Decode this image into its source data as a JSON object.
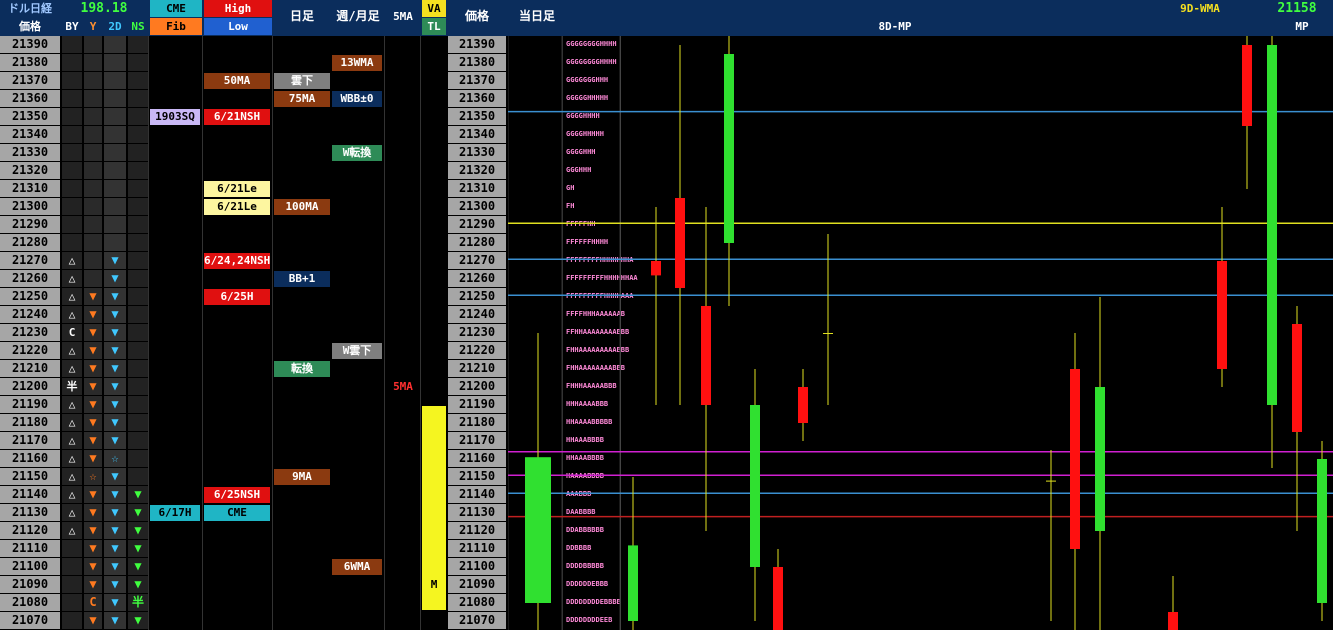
{
  "header": {
    "dollar_nikkei_label": "ドル日経",
    "dollar_nikkei_value": "198.18",
    "price_label": "価格",
    "by": "BY",
    "y": "Y",
    "twod": "2D",
    "ns": "NS",
    "cme": "CME",
    "fib": "Fib",
    "high": "High",
    "low": "Low",
    "daily": "日足",
    "weekly_monthly": "週/月足",
    "ma5": "5MA",
    "va": "VA",
    "tl": "TL",
    "price_label2": "価格",
    "today_candle": "当日足",
    "mp8d": "8D-MP",
    "wma9d": "9D-WMA",
    "mp_value": "21158",
    "mp": "MP"
  },
  "rows": [
    {
      "price": "21390",
      "by": "",
      "y": "",
      "d2": "",
      "ns": "",
      "cme": "",
      "hl": "",
      "hl_color": "",
      "daily": "",
      "weekly": "",
      "tpo": "GGGGGGGGHHHH"
    },
    {
      "price": "21380",
      "by": "",
      "y": "",
      "d2": "",
      "ns": "",
      "cme": "",
      "hl": "",
      "hl_color": "",
      "daily": "",
      "weekly": "13WMA",
      "tpo": "GGGGGGGGHHHH"
    },
    {
      "price": "21370",
      "by": "",
      "y": "",
      "d2": "",
      "ns": "",
      "cme": "",
      "hl": "50MA",
      "hl_color": "#8b3a10",
      "daily": "雲下",
      "weekly": "",
      "tpo": "GGGGGGGHHH"
    },
    {
      "price": "21360",
      "by": "",
      "y": "",
      "d2": "",
      "ns": "",
      "cme": "",
      "hl": "",
      "hl_color": "",
      "daily": "75MA",
      "weekly": "WBB±0",
      "tpo": "GGGGGHHHHH"
    },
    {
      "price": "21350",
      "by": "",
      "y": "",
      "d2": "",
      "ns": "",
      "cme": "1903SQ",
      "hl": "6/21NSH",
      "hl_color": "#e01010",
      "daily": "",
      "weekly": "",
      "tpo": "GGGGHHHH"
    },
    {
      "price": "21340",
      "by": "",
      "y": "",
      "d2": "",
      "ns": "",
      "cme": "",
      "hl": "",
      "hl_color": "",
      "daily": "",
      "weekly": "",
      "tpo": "GGGGHHHHH"
    },
    {
      "price": "21330",
      "by": "",
      "y": "",
      "d2": "",
      "ns": "",
      "cme": "",
      "hl": "",
      "hl_color": "",
      "daily": "",
      "weekly": "W転換",
      "tpo": "GGGGHHH"
    },
    {
      "price": "21320",
      "by": "",
      "y": "",
      "d2": "",
      "ns": "",
      "cme": "",
      "hl": "",
      "hl_color": "",
      "daily": "",
      "weekly": "",
      "tpo": "GGGHHH"
    },
    {
      "price": "21310",
      "by": "",
      "y": "",
      "d2": "",
      "ns": "",
      "cme": "",
      "hl": "6/21Le",
      "hl_color": "#fdf6a0",
      "daily": "",
      "weekly": "",
      "tpo": "GH"
    },
    {
      "price": "21300",
      "by": "",
      "y": "",
      "d2": "",
      "ns": "",
      "cme": "",
      "hl": "6/21Le",
      "hl_color": "#fdf6a0",
      "daily": "100MA",
      "weekly": "",
      "tpo": "FH"
    },
    {
      "price": "21290",
      "by": "",
      "y": "",
      "d2": "",
      "ns": "",
      "cme": "",
      "hl": "",
      "hl_color": "",
      "daily": "",
      "weekly": "",
      "tpo": "FFFFFHH"
    },
    {
      "price": "21280",
      "by": "",
      "y": "",
      "d2": "",
      "ns": "",
      "cme": "",
      "hl": "",
      "hl_color": "",
      "daily": "",
      "weekly": "",
      "tpo": "FFFFFFHHHH"
    },
    {
      "price": "21270",
      "by": "△",
      "y": "",
      "d2": "▼",
      "ns": "",
      "cme": "",
      "hl": "6/24,24NSH",
      "hl_color": "#e01010",
      "daily": "",
      "weekly": "",
      "tpo": "FFFFFFFFHHHHHHHA"
    },
    {
      "price": "21260",
      "by": "△",
      "y": "",
      "d2": "▼",
      "ns": "",
      "cme": "",
      "hl": "",
      "hl_color": "",
      "daily": "BB+1",
      "weekly": "",
      "tpo": "FFFFFFFFFHHHHHHAA"
    },
    {
      "price": "21250",
      "by": "△",
      "y": "▼",
      "d2": "▼",
      "ns": "",
      "cme": "",
      "hl": "6/25H",
      "hl_color": "#e01010",
      "daily": "",
      "weekly": "",
      "tpo": "FFFFFFFFFHHHHAAA"
    },
    {
      "price": "21240",
      "by": "△",
      "y": "▼",
      "d2": "▼",
      "ns": "",
      "cme": "",
      "hl": "",
      "hl_color": "",
      "daily": "",
      "weekly": "",
      "tpo": "FFFFHHHAAAAAAB"
    },
    {
      "price": "21230",
      "by": "C",
      "y": "▼",
      "d2": "▼",
      "ns": "",
      "cme": "",
      "hl": "",
      "hl_color": "",
      "daily": "",
      "weekly": "",
      "tpo": "FFHHAAAAAAAABBB"
    },
    {
      "price": "21220",
      "by": "△",
      "y": "▼",
      "d2": "▼",
      "ns": "",
      "cme": "",
      "hl": "",
      "hl_color": "",
      "daily": "",
      "weekly": "W雲下",
      "tpo": "FHHAAAAAAAAABBB"
    },
    {
      "price": "21210",
      "by": "△",
      "y": "▼",
      "d2": "▼",
      "ns": "",
      "cme": "",
      "hl": "",
      "hl_color": "",
      "daily": "転換",
      "weekly": "",
      "tpo": "FHHAAAAAAAABBB"
    },
    {
      "price": "21200",
      "by": "半",
      "y": "▼",
      "d2": "▼",
      "ns": "",
      "cme": "",
      "hl": "",
      "hl_color": "",
      "daily": "",
      "weekly": "",
      "tpo": "FHHHAAAAABBB"
    },
    {
      "price": "21190",
      "by": "△",
      "y": "▼",
      "d2": "▼",
      "ns": "",
      "cme": "",
      "hl": "",
      "hl_color": "",
      "daily": "",
      "weekly": "",
      "tpo": "HHHAAAABBB"
    },
    {
      "price": "21180",
      "by": "△",
      "y": "▼",
      "d2": "▼",
      "ns": "",
      "cme": "",
      "hl": "",
      "hl_color": "",
      "daily": "",
      "weekly": "",
      "tpo": "HHAAAABBBBB"
    },
    {
      "price": "21170",
      "by": "△",
      "y": "▼",
      "d2": "▼",
      "ns": "",
      "cme": "",
      "hl": "",
      "hl_color": "",
      "daily": "",
      "weekly": "",
      "tpo": "HHAAABBBB"
    },
    {
      "price": "21160",
      "by": "△",
      "y": "▼",
      "d2": "☆",
      "ns": "",
      "cme": "",
      "hl": "",
      "hl_color": "",
      "daily": "",
      "weekly": "",
      "tpo": "HHAAABBBB"
    },
    {
      "price": "21150",
      "by": "△",
      "y": "☆",
      "d2": "▼",
      "ns": "",
      "cme": "",
      "hl": "",
      "hl_color": "",
      "daily": "9MA",
      "weekly": "",
      "tpo": "HAAAABBBB"
    },
    {
      "price": "21140",
      "by": "△",
      "y": "▼",
      "d2": "▼",
      "ns": "▼",
      "cme": "",
      "hl": "6/25NSH",
      "hl_color": "#e01010",
      "daily": "",
      "weekly": "",
      "tpo": "AAABBB"
    },
    {
      "price": "21130",
      "by": "△",
      "y": "▼",
      "d2": "▼",
      "ns": "▼",
      "cme": "6/17H",
      "hl": "CME",
      "hl_color": "#1fb5c5",
      "daily": "",
      "weekly": "",
      "tpo": "DAABBBB"
    },
    {
      "price": "21120",
      "by": "△",
      "y": "▼",
      "d2": "▼",
      "ns": "▼",
      "cme": "",
      "hl": "",
      "hl_color": "",
      "daily": "",
      "weekly": "",
      "tpo": "DDABBBBBB"
    },
    {
      "price": "21110",
      "by": "",
      "y": "▼",
      "d2": "▼",
      "ns": "▼",
      "cme": "",
      "hl": "",
      "hl_color": "",
      "daily": "",
      "weekly": "",
      "tpo": "DDBBBB"
    },
    {
      "price": "21100",
      "by": "",
      "y": "▼",
      "d2": "▼",
      "ns": "▼",
      "cme": "",
      "hl": "",
      "hl_color": "",
      "daily": "",
      "weekly": "6WMA",
      "tpo": "DDDDBBBBB"
    },
    {
      "price": "21090",
      "by": "",
      "y": "▼",
      "d2": "▼",
      "ns": "▼",
      "cme": "",
      "hl": "",
      "hl_color": "",
      "daily": "",
      "weekly": "",
      "tpo": "DDDDDDEBBB"
    },
    {
      "price": "21080",
      "by": "",
      "y": "C",
      "d2": "▼",
      "ns": "半",
      "cme": "",
      "hl": "",
      "hl_color": "",
      "daily": "",
      "weekly": "",
      "tpo": "DDDDDDDDEBBBB"
    },
    {
      "price": "21070",
      "by": "",
      "y": "▼",
      "d2": "▼",
      "ns": "▼",
      "cme": "",
      "hl": "",
      "hl_color": "",
      "daily": "",
      "weekly": "",
      "tpo": "DDDDDDDDEEB"
    }
  ],
  "weekly_tags": {
    "13WMA": "#8b3a10",
    "6WMA": "#8b3a10",
    "WBB±0": "#0b2d5c",
    "W転換": "#2e8b57",
    "W雲下": "#7f7f7f"
  },
  "daily_tags": {
    "75MA": "#8b3a10",
    "100MA": "#8b3a10",
    "9MA": "#8b3a10",
    "BB+1": "#0b2d5c",
    "転換": "#2e8b57",
    "雲下": "#7f7f7f"
  },
  "ma5_label": {
    "text": "5MA",
    "price": "21200",
    "color": "#ff3030"
  },
  "va_marker": {
    "text": "M",
    "price": "21090"
  },
  "chart_data": {
    "type": "candlestick",
    "title": "",
    "ylim": [
      21065,
      21395
    ],
    "horizontal_lines": [
      {
        "price": 21353,
        "color": "#3a8fd0"
      },
      {
        "price": 21291,
        "color": "#e0e020"
      },
      {
        "price": 21271,
        "color": "#3a8fd0"
      },
      {
        "price": 21251,
        "color": "#3a8fd0"
      },
      {
        "price": 21164,
        "color": "#d020d0"
      },
      {
        "price": 21151,
        "color": "#d020d0"
      },
      {
        "price": 21141,
        "color": "#3a8fd0"
      },
      {
        "price": 21128,
        "color": "#c02020"
      }
    ],
    "today_candle": {
      "open": 21080,
      "close": 21161,
      "high": 21230,
      "low": 21065,
      "color": "#30e030"
    },
    "candles": [
      {
        "x": 633,
        "open": 21070,
        "close": 21112,
        "high": 21150,
        "low": 21060,
        "color": "#30e030"
      },
      {
        "x": 656,
        "open": 21270,
        "close": 21262,
        "high": 21300,
        "low": 21190,
        "color": "#ff1010"
      },
      {
        "x": 680,
        "open": 21305,
        "close": 21255,
        "high": 21390,
        "low": 21190,
        "color": "#ff1010"
      },
      {
        "x": 706,
        "open": 21245,
        "close": 21190,
        "high": 21300,
        "low": 21120,
        "color": "#ff1010"
      },
      {
        "x": 729,
        "open": 21280,
        "close": 21385,
        "high": 21395,
        "low": 21245,
        "color": "#30e030"
      },
      {
        "x": 755,
        "open": 21100,
        "close": 21190,
        "high": 21210,
        "low": 21070,
        "color": "#30e030"
      },
      {
        "x": 778,
        "open": 21100,
        "close": 21060,
        "high": 21110,
        "low": 21030,
        "color": "#ff1010"
      },
      {
        "x": 803,
        "open": 21200,
        "close": 21180,
        "high": 21210,
        "low": 21170,
        "color": "#ff1010"
      },
      {
        "x": 828,
        "open": 21230,
        "close": 21230,
        "high": 21285,
        "low": 21190,
        "color": "#e0e020"
      },
      {
        "x": 1051,
        "open": 21148,
        "close": 21148,
        "high": 21165,
        "low": 21070,
        "color": "#e0e020"
      },
      {
        "x": 1075,
        "open": 21210,
        "close": 21110,
        "high": 21230,
        "low": 21065,
        "color": "#ff1010"
      },
      {
        "x": 1100,
        "open": 21120,
        "close": 21200,
        "high": 21250,
        "low": 21065,
        "color": "#30e030"
      },
      {
        "x": 1173,
        "open": 21075,
        "close": 21060,
        "high": 21095,
        "low": 21040,
        "color": "#ff1010"
      },
      {
        "x": 1222,
        "open": 21270,
        "close": 21210,
        "high": 21300,
        "low": 21200,
        "color": "#ff1010"
      },
      {
        "x": 1247,
        "open": 21390,
        "close": 21345,
        "high": 21395,
        "low": 21310,
        "color": "#ff1010"
      },
      {
        "x": 1272,
        "open": 21190,
        "close": 21390,
        "high": 21395,
        "low": 21155,
        "color": "#30e030"
      },
      {
        "x": 1297,
        "open": 21235,
        "close": 21175,
        "high": 21245,
        "low": 21120,
        "color": "#ff1010"
      },
      {
        "x": 1322,
        "open": 21080,
        "close": 21160,
        "high": 21170,
        "low": 21070,
        "color": "#30e030"
      }
    ]
  }
}
